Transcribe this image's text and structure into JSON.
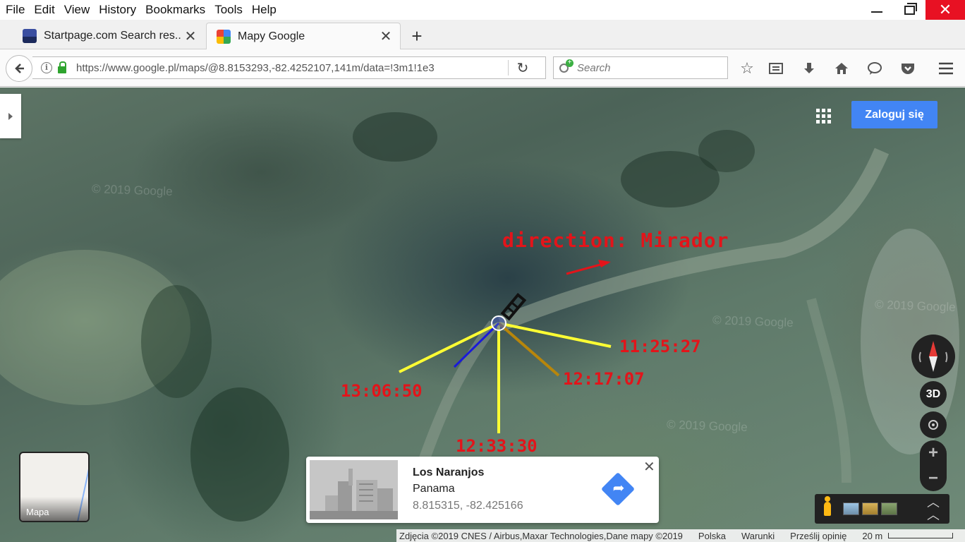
{
  "browser": {
    "menu": [
      "File",
      "Edit",
      "View",
      "History",
      "Bookmarks",
      "Tools",
      "Help"
    ],
    "window_controls": {
      "close": "✕"
    },
    "tabs": [
      {
        "title": "Startpage.com Search res...",
        "close": "✕"
      },
      {
        "title": "Mapy Google",
        "close": "✕"
      }
    ],
    "new_tab": "+",
    "url": "https://www.google.pl/maps/@8.8153293,-82.4252107,141m/data=!3m1!1e3",
    "search_placeholder": "Search",
    "icons": [
      "back-arrow-icon",
      "info-icon",
      "lock-icon",
      "reload-icon",
      "star-icon",
      "reading-list-icon",
      "download-icon",
      "home-icon",
      "chat-icon",
      "pocket-icon",
      "hamburger-menu-icon"
    ]
  },
  "map": {
    "signin_label": "Zaloguj się",
    "watermark": "© 2019 Google",
    "annotation_title": "direction: Mirador",
    "time_labels": [
      "11:25:27",
      "12:17:07",
      "13:06:50",
      "12:33:30"
    ],
    "line_colors": {
      "annotation": "#e3141a",
      "sun_lines": "#ffff33",
      "shadow_blue": "#1a1ad8",
      "shadow_brown": "#b8860b"
    },
    "controls": {
      "three_d": "3D",
      "zoom_in": "+",
      "zoom_out": "−",
      "expand": "⌃"
    },
    "layer_tile_label": "Mapa",
    "info_card": {
      "name": "Los Naranjos",
      "country": "Panama",
      "coords": "8.815315, -82.425166",
      "close": "✕"
    },
    "attribution": {
      "imagery": "Zdjęcia ©2019 CNES / Airbus,Maxar Technologies,Dane mapy ©2019",
      "country": "Polska",
      "terms": "Warunki",
      "feedback": "Prześlij opinię",
      "scale": "20 m"
    }
  }
}
